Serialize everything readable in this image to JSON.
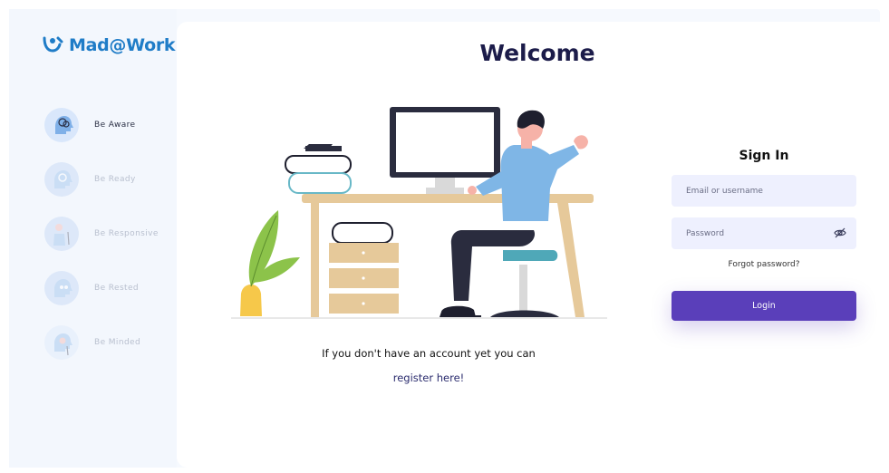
{
  "app": {
    "brand": "Mad@Work"
  },
  "sidebar": {
    "items": [
      {
        "label": "Be Aware",
        "active": true,
        "icon": "brain-head-icon"
      },
      {
        "label": "Be Ready",
        "active": false,
        "icon": "target-head-icon"
      },
      {
        "label": "Be Responsive",
        "active": false,
        "icon": "person-support-icon"
      },
      {
        "label": "Be Rested",
        "active": false,
        "icon": "rest-head-icon"
      },
      {
        "label": "Be Minded",
        "active": false,
        "icon": "mindful-person-icon"
      }
    ]
  },
  "main": {
    "title": "Welcome",
    "register_text": "If you don't have an account yet you can",
    "register_link": "register here!"
  },
  "signin": {
    "title": "Sign In",
    "email_placeholder": "Email or username",
    "password_placeholder": "Password",
    "forgot": "Forgot password?",
    "login": "Login"
  },
  "colors": {
    "brand": "#1f7cc7",
    "primary_button": "#5a3fba",
    "input_bg": "#eef0fe",
    "title": "#1c1c4a",
    "link": "#2b2c6e"
  }
}
